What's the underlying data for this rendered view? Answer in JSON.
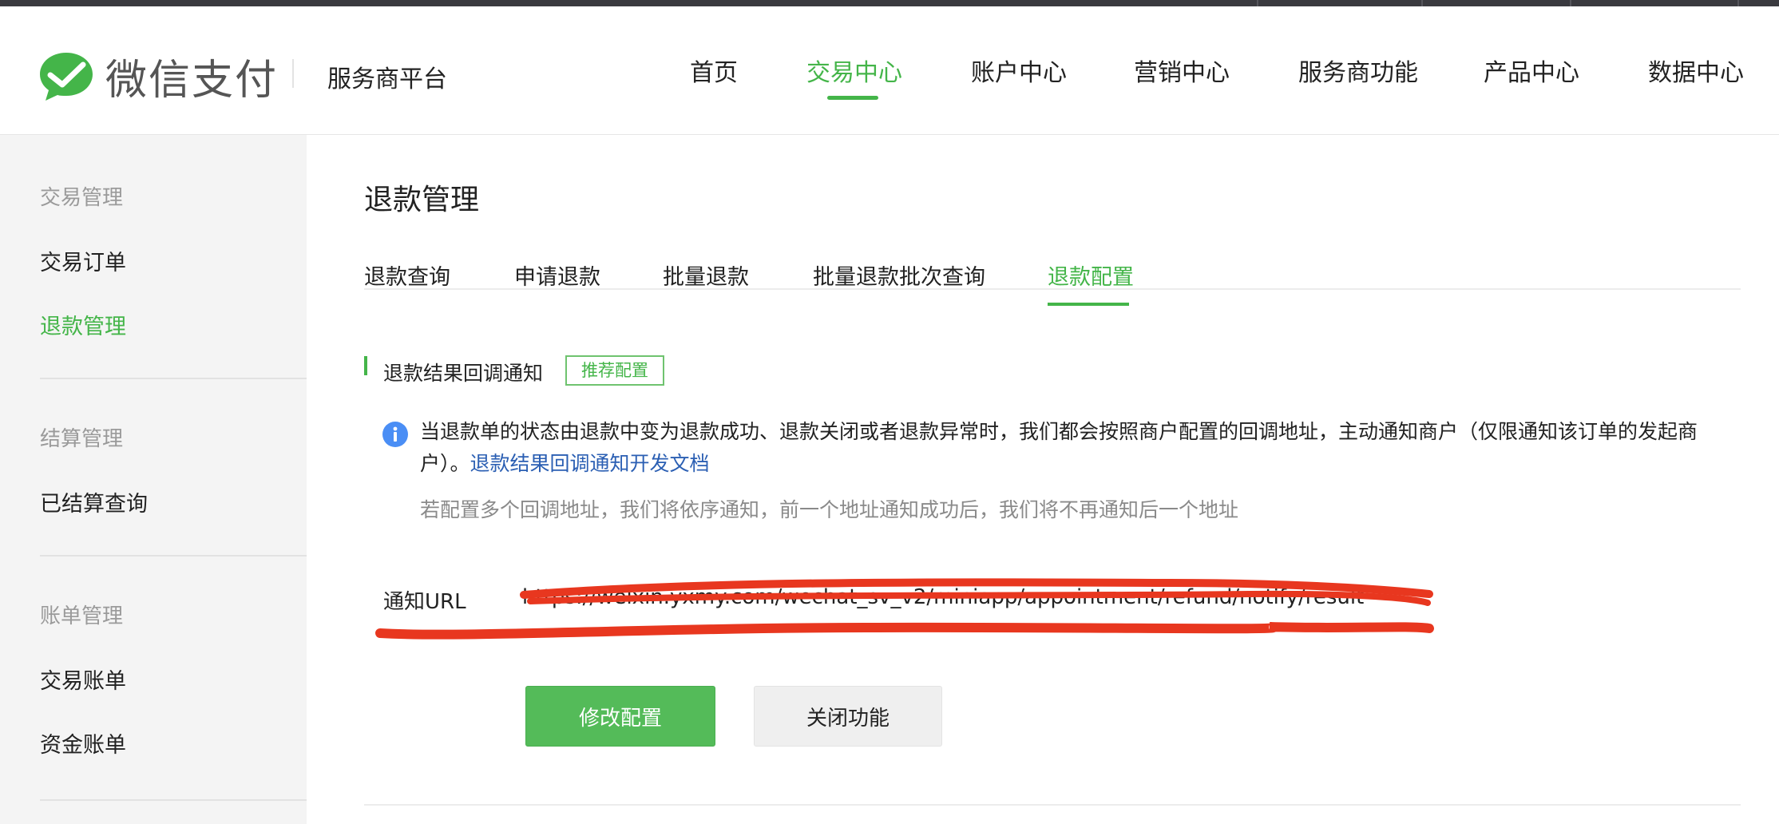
{
  "header": {
    "brand": "微信支付",
    "platform": "服务商平台",
    "nav": [
      {
        "label": "首页",
        "active": false
      },
      {
        "label": "交易中心",
        "active": true
      },
      {
        "label": "账户中心",
        "active": false
      },
      {
        "label": "营销中心",
        "active": false
      },
      {
        "label": "服务商功能",
        "active": false
      },
      {
        "label": "产品中心",
        "active": false
      },
      {
        "label": "数据中心",
        "active": false
      }
    ]
  },
  "sidebar": {
    "groups": [
      {
        "title": "交易管理",
        "items": [
          {
            "label": "交易订单",
            "active": false
          },
          {
            "label": "退款管理",
            "active": true
          }
        ]
      },
      {
        "title": "结算管理",
        "items": [
          {
            "label": "已结算查询",
            "active": false
          }
        ]
      },
      {
        "title": "账单管理",
        "items": [
          {
            "label": "交易账单",
            "active": false
          },
          {
            "label": "资金账单",
            "active": false
          }
        ]
      }
    ]
  },
  "main": {
    "title": "退款管理",
    "tabs": [
      {
        "label": "退款查询",
        "active": false
      },
      {
        "label": "申请退款",
        "active": false
      },
      {
        "label": "批量退款",
        "active": false
      },
      {
        "label": "批量退款批次查询",
        "active": false
      },
      {
        "label": "退款配置",
        "active": true
      }
    ],
    "section": {
      "title": "退款结果回调通知",
      "badge": "推荐配置",
      "info_text": "当退款单的状态由退款中变为退款成功、退款关闭或者退款异常时，我们都会按照商户配置的回调地址，主动通知商户（仅限通知该订单的发起商户）。",
      "info_link": "退款结果回调通知开发文档",
      "note": "若配置多个回调地址，我们将依序通知，前一个地址通知成功后，我们将不再通知后一个地址",
      "url_label": "通知URL",
      "url_value": "https://weixin.yxmy.com/wechat_sv_v2/miniapp/appointment/refund/notify/result",
      "btn_modify": "修改配置",
      "btn_close": "关闭功能"
    }
  },
  "colors": {
    "accent": "#44b549",
    "link": "#2b5fb3",
    "info_icon": "#4a8ef5",
    "redaction": "#e8371f"
  }
}
